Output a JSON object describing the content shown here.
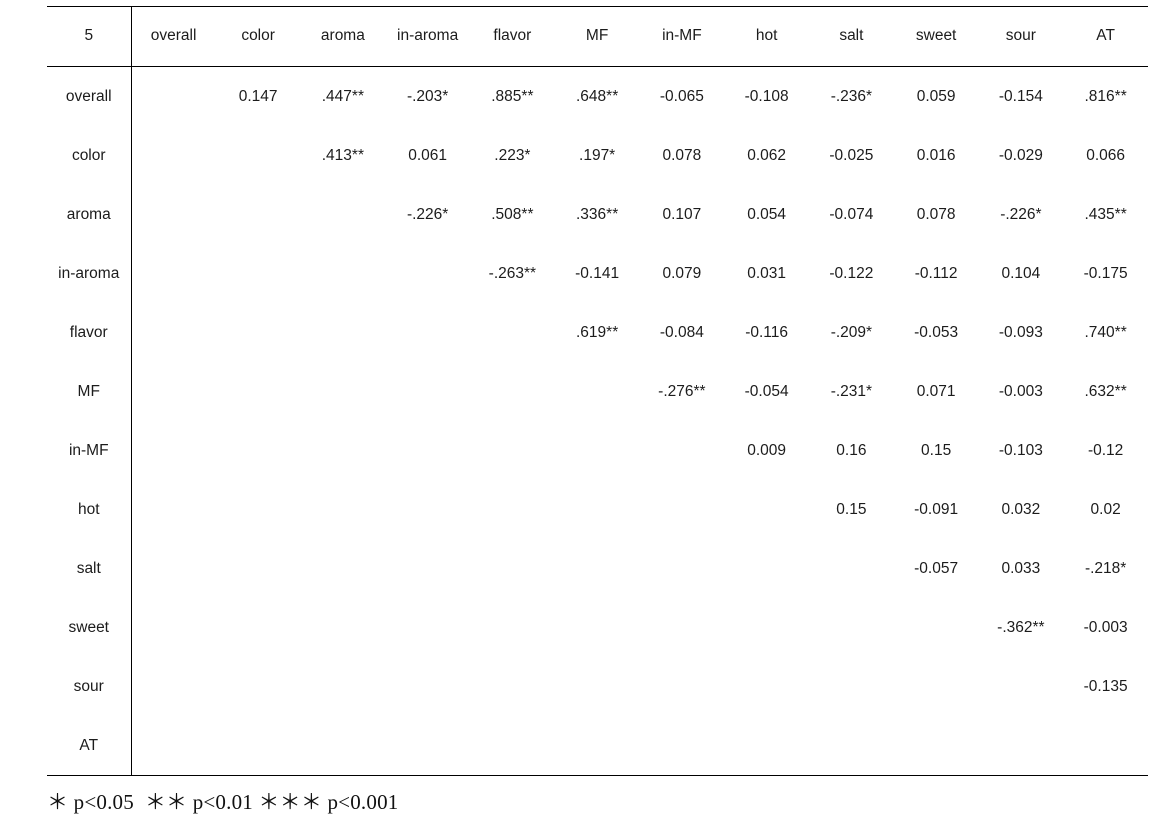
{
  "table": {
    "corner_label": "5",
    "columns": [
      "overall",
      "color",
      "aroma",
      "in-aroma",
      "flavor",
      "MF",
      "in-MF",
      "hot",
      "salt",
      "sweet",
      "sour",
      "AT"
    ],
    "row_labels": [
      "overall",
      "color",
      "aroma",
      "in-aroma",
      "flavor",
      "MF",
      "in-MF",
      "hot",
      "salt",
      "sweet",
      "sour",
      "AT"
    ],
    "rows": [
      {
        "label": "overall",
        "cells": [
          "",
          "0.147",
          ".447**",
          "-.203*",
          ".885**",
          ".648**",
          "-0.065",
          "-0.108",
          "-.236*",
          "0.059",
          "-0.154",
          ".816**"
        ]
      },
      {
        "label": "color",
        "cells": [
          "",
          "",
          ".413**",
          "0.061",
          ".223*",
          ".197*",
          "0.078",
          "0.062",
          "-0.025",
          "0.016",
          "-0.029",
          "0.066"
        ]
      },
      {
        "label": "aroma",
        "cells": [
          "",
          "",
          "",
          "-.226*",
          ".508**",
          ".336**",
          "0.107",
          "0.054",
          "-0.074",
          "0.078",
          "-.226*",
          ".435**"
        ]
      },
      {
        "label": "in-aroma",
        "cells": [
          "",
          "",
          "",
          "",
          "-.263**",
          "-0.141",
          "0.079",
          "0.031",
          "-0.122",
          "-0.112",
          "0.104",
          "-0.175"
        ]
      },
      {
        "label": "flavor",
        "cells": [
          "",
          "",
          "",
          "",
          "",
          ".619**",
          "-0.084",
          "-0.116",
          "-.209*",
          "-0.053",
          "-0.093",
          ".740**"
        ]
      },
      {
        "label": "MF",
        "cells": [
          "",
          "",
          "",
          "",
          "",
          "",
          "-.276**",
          "-0.054",
          "-.231*",
          "0.071",
          "-0.003",
          ".632**"
        ]
      },
      {
        "label": "in-MF",
        "cells": [
          "",
          "",
          "",
          "",
          "",
          "",
          "",
          "0.009",
          "0.16",
          "0.15",
          "-0.103",
          "-0.12"
        ]
      },
      {
        "label": "hot",
        "cells": [
          "",
          "",
          "",
          "",
          "",
          "",
          "",
          "",
          "0.15",
          "-0.091",
          "0.032",
          "0.02"
        ]
      },
      {
        "label": "salt",
        "cells": [
          "",
          "",
          "",
          "",
          "",
          "",
          "",
          "",
          "",
          "-0.057",
          "0.033",
          "-.218*"
        ]
      },
      {
        "label": "sweet",
        "cells": [
          "",
          "",
          "",
          "",
          "",
          "",
          "",
          "",
          "",
          "",
          "-.362**",
          "-0.003"
        ]
      },
      {
        "label": "sour",
        "cells": [
          "",
          "",
          "",
          "",
          "",
          "",
          "",
          "",
          "",
          "",
          "",
          "-0.135"
        ]
      },
      {
        "label": "AT",
        "cells": [
          "",
          "",
          "",
          "",
          "",
          "",
          "",
          "",
          "",
          "",
          "",
          ""
        ]
      }
    ]
  },
  "footnote": "＊ p<0.05  ＊＊ p<0.01 ＊＊＊ p<0.001"
}
